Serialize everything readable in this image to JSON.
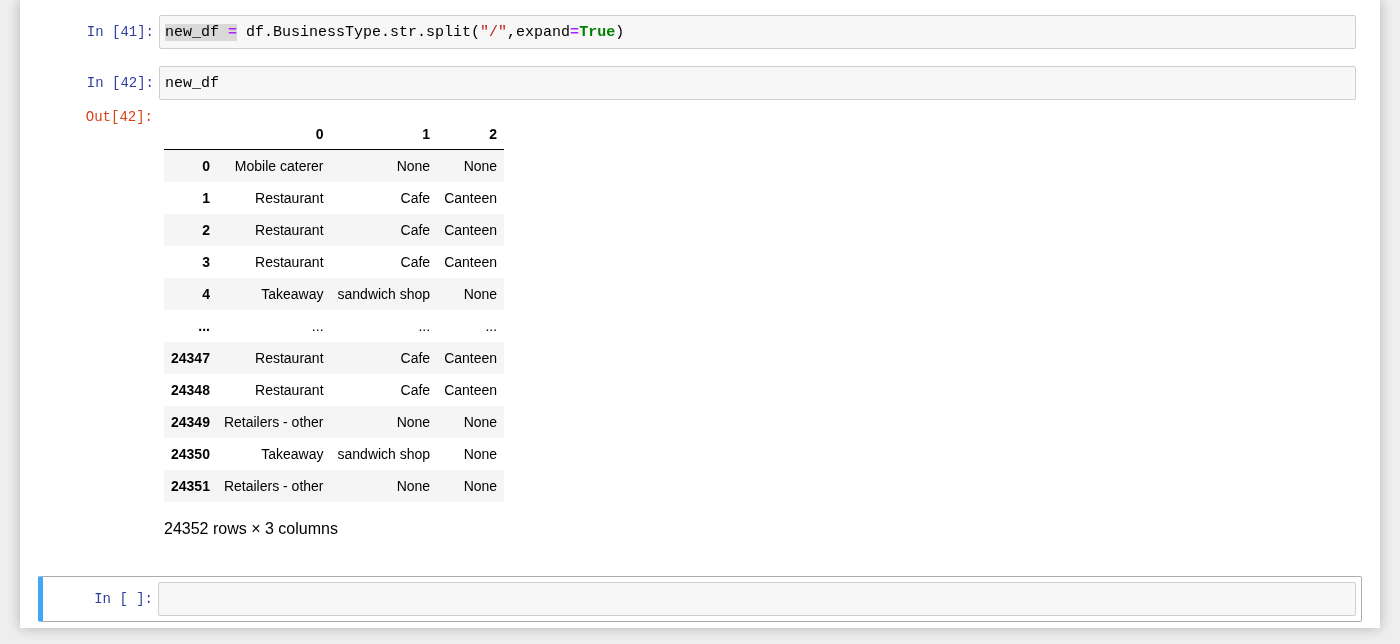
{
  "cells": [
    {
      "prompt": "In [41]:",
      "selected": false,
      "code": [
        {
          "text": "new_df ",
          "kind": "plain",
          "highlighted": true
        },
        {
          "text": "=",
          "kind": "operator",
          "highlighted": true
        },
        {
          "text": " df.BusinessType.str.split(",
          "kind": "plain",
          "highlighted": false
        },
        {
          "text": "\"/\"",
          "kind": "string",
          "highlighted": false
        },
        {
          "text": ",expand",
          "kind": "plain",
          "highlighted": false
        },
        {
          "text": "=",
          "kind": "operator",
          "highlighted": false
        },
        {
          "text": "True",
          "kind": "keyword",
          "highlighted": false
        },
        {
          "text": ")",
          "kind": "plain",
          "highlighted": false
        }
      ]
    },
    {
      "prompt": "In [42]:",
      "selected": false,
      "code": [
        {
          "text": "new_df",
          "kind": "plain",
          "highlighted": false
        }
      ],
      "output": {
        "prompt": "Out[42]:",
        "table": {
          "columns": [
            "0",
            "1",
            "2"
          ],
          "rows": [
            {
              "index": "0",
              "cells": [
                "Mobile caterer",
                "None",
                "None"
              ]
            },
            {
              "index": "1",
              "cells": [
                "Restaurant",
                "Cafe",
                "Canteen"
              ]
            },
            {
              "index": "2",
              "cells": [
                "Restaurant",
                "Cafe",
                "Canteen"
              ]
            },
            {
              "index": "3",
              "cells": [
                "Restaurant",
                "Cafe",
                "Canteen"
              ]
            },
            {
              "index": "4",
              "cells": [
                "Takeaway",
                "sandwich shop",
                "None"
              ]
            },
            {
              "index": "...",
              "cells": [
                "...",
                "...",
                "..."
              ]
            },
            {
              "index": "24347",
              "cells": [
                "Restaurant",
                "Cafe",
                "Canteen"
              ]
            },
            {
              "index": "24348",
              "cells": [
                "Restaurant",
                "Cafe",
                "Canteen"
              ]
            },
            {
              "index": "24349",
              "cells": [
                "Retailers - other",
                "None",
                "None"
              ]
            },
            {
              "index": "24350",
              "cells": [
                "Takeaway",
                "sandwich shop",
                "None"
              ]
            },
            {
              "index": "24351",
              "cells": [
                "Retailers - other",
                "None",
                "None"
              ]
            }
          ]
        },
        "summary": "24352 rows × 3 columns"
      }
    },
    {
      "prompt": "In [ ]:",
      "selected": true
    }
  ]
}
